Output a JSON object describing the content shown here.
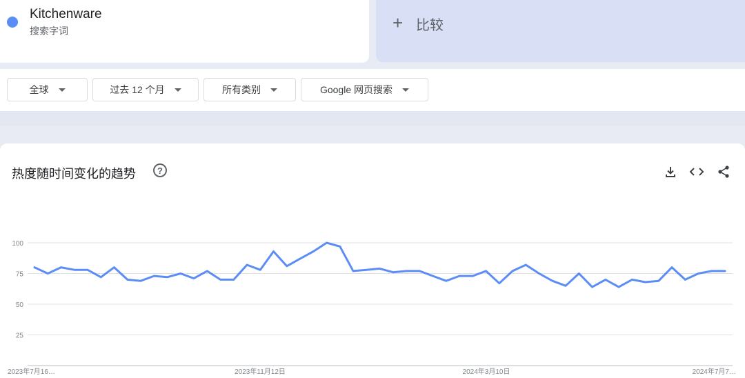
{
  "search_term": {
    "name": "Kitchenware",
    "type": "搜索字词",
    "color": "#5c8df6"
  },
  "compare": {
    "label": "比较"
  },
  "filters": [
    {
      "label": "全球"
    },
    {
      "label": "过去 12 个月"
    },
    {
      "label": "所有类别"
    },
    {
      "label": "Google 网页搜索"
    }
  ],
  "chart": {
    "title": "热度随时间变化的趋势",
    "toolbar": [
      "download-icon",
      "embed-code-icon",
      "share-icon"
    ]
  },
  "chart_data": {
    "type": "line",
    "title": "热度随时间变化的趋势",
    "ylim": [
      0,
      100
    ],
    "y_ticks": [
      25,
      50,
      75,
      100
    ],
    "x_tick_labels": [
      "2023年7月16…",
      "2023年11月12日",
      "2024年3月10日",
      "2024年7月7…"
    ],
    "grid": true,
    "legend": "none",
    "series": [
      {
        "color": "#5c8df6",
        "values": [
          80,
          75,
          80,
          78,
          78,
          72,
          80,
          70,
          69,
          73,
          72,
          75,
          71,
          77,
          70,
          70,
          82,
          78,
          93,
          81,
          87,
          93,
          100,
          97,
          77,
          78,
          79,
          76,
          77,
          77,
          73,
          69,
          73,
          73,
          77,
          67,
          77,
          82,
          75,
          69,
          65,
          75,
          64,
          70,
          64,
          70,
          68,
          69,
          80,
          70,
          75,
          77,
          77
        ]
      }
    ]
  }
}
